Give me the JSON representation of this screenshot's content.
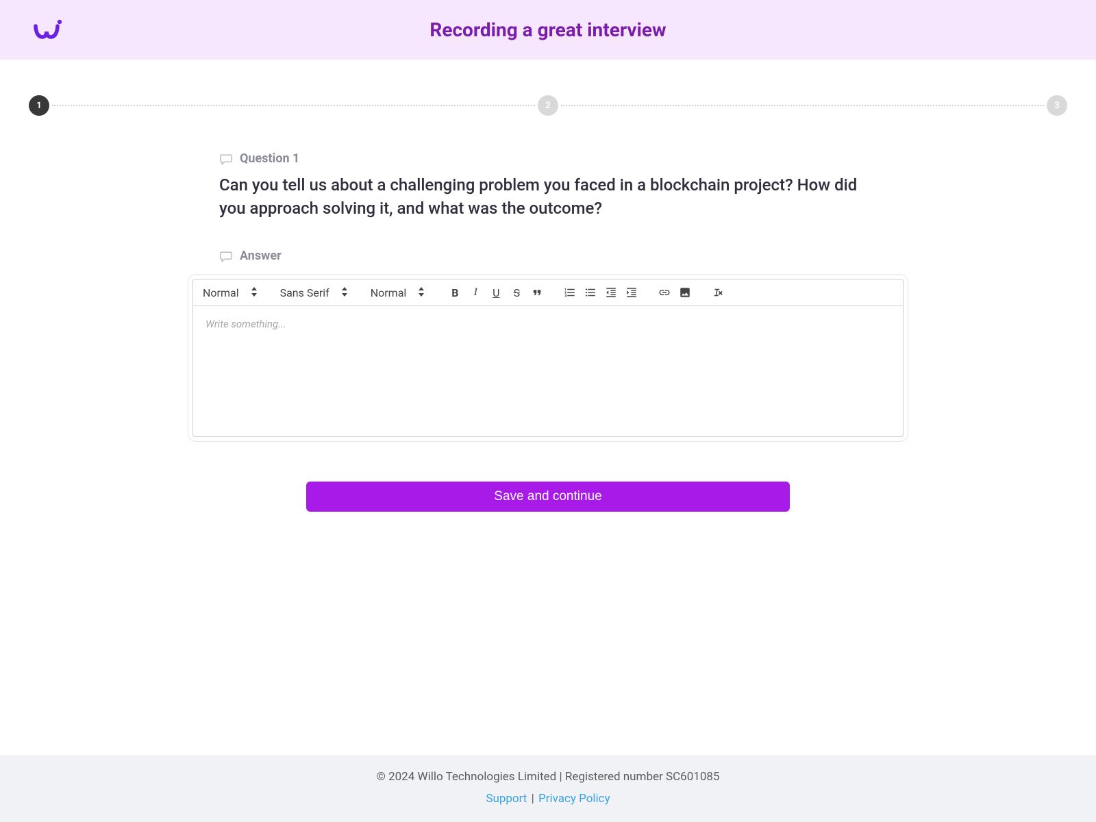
{
  "header": {
    "title": "Recording a great interview"
  },
  "progress": {
    "steps": [
      "1",
      "2",
      "3"
    ],
    "active_index": 0
  },
  "question": {
    "label": "Question 1",
    "text": "Can you tell us about a challenging problem you faced in a blockchain project? How did you approach solving it, and what was the outcome?"
  },
  "answer": {
    "label": "Answer",
    "placeholder": "Write something..."
  },
  "editor_toolbar": {
    "heading": "Normal",
    "font": "Sans Serif",
    "size": "Normal"
  },
  "actions": {
    "save_continue": "Save and continue"
  },
  "footer": {
    "copyright": "© 2024 Willo Technologies Limited | Registered number SC601085",
    "support": "Support",
    "privacy": "Privacy Policy"
  }
}
